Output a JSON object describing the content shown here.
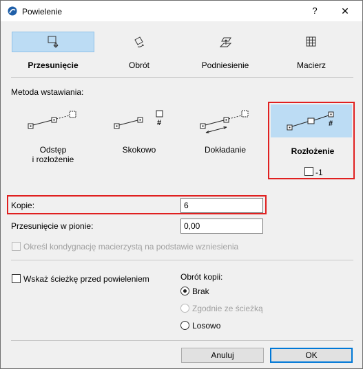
{
  "window": {
    "title": "Powielenie",
    "help": "?",
    "close": "✕"
  },
  "tabs": [
    {
      "label": "Przesunięcie",
      "icon": "move-icon",
      "selected": true
    },
    {
      "label": "Obrót",
      "icon": "rotate-icon",
      "selected": false
    },
    {
      "label": "Podniesienie",
      "icon": "elevate-icon",
      "selected": false
    },
    {
      "label": "Macierz",
      "icon": "matrix-icon",
      "selected": false
    }
  ],
  "method": {
    "label": "Metoda wstawiania:",
    "options": [
      {
        "label": "Odstęp\ni rozłożenie",
        "selected": false
      },
      {
        "label": "Skokowo",
        "selected": false
      },
      {
        "label": "Dokładanie",
        "selected": false
      },
      {
        "label": "Rozłożenie",
        "selected": true
      }
    ],
    "hash": "#",
    "minus_one_label": "-1"
  },
  "fields": {
    "copies_label": "Kopie:",
    "copies_value": "6",
    "vertical_label": "Przesunięcie w pionie:",
    "vertical_value": "0,00",
    "story_label": "Określ kondygnację macierzystą na podstawie wzniesienia"
  },
  "options": {
    "show_path_label": "Wskaż ścieżkę przed powieleniem",
    "rotation_title": "Obrót kopii:",
    "rotation_options": [
      {
        "label": "Brak",
        "selected": true,
        "disabled": false
      },
      {
        "label": "Zgodnie ze ścieżką",
        "selected": false,
        "disabled": true
      },
      {
        "label": "Losowo",
        "selected": false,
        "disabled": false
      }
    ]
  },
  "buttons": {
    "cancel": "Anuluj",
    "ok": "OK"
  },
  "colors": {
    "highlight": "#bcdcf4",
    "annotation": "#e02020",
    "default_button": "#0078d7"
  }
}
